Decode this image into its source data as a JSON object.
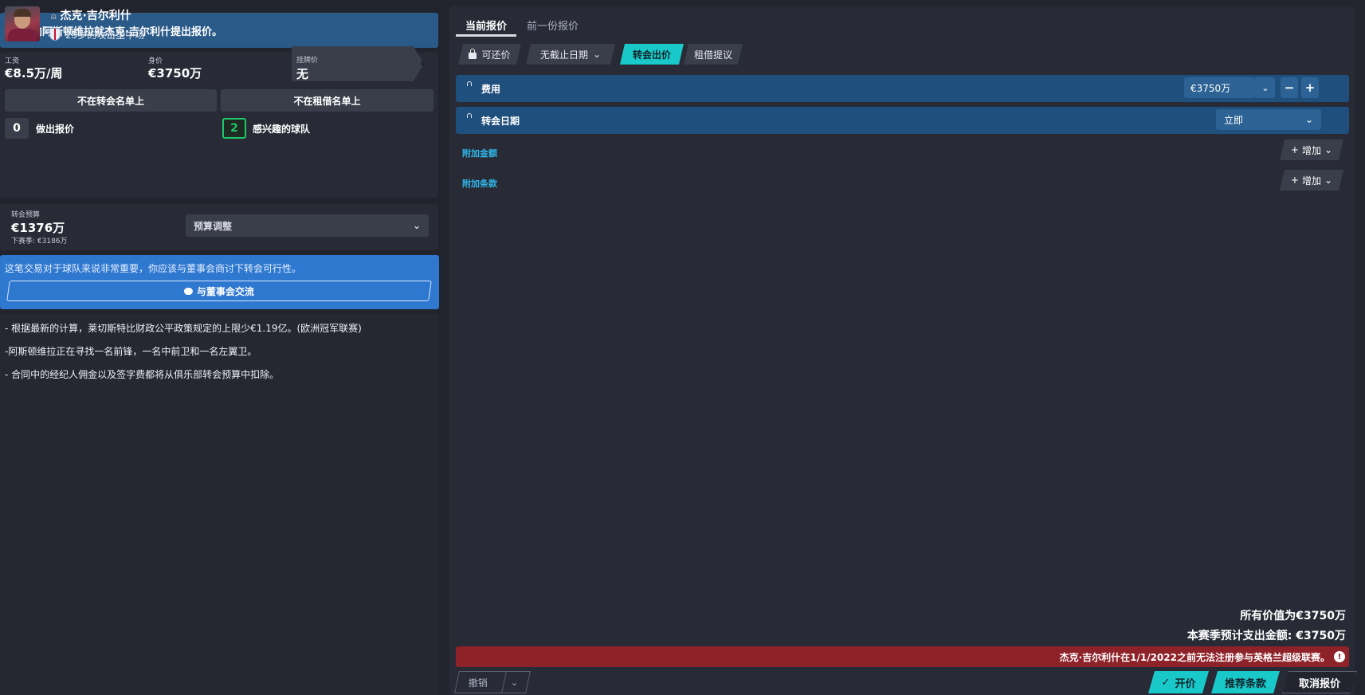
{
  "banner": {
    "text": "向阿斯顿维拉就杰克·吉尔利什提出报价。"
  },
  "player": {
    "name": "杰克·吉尔利什",
    "description": "25岁的攻击型中场",
    "wage_label": "工资",
    "wage_value": "€8.5万/周",
    "value_label": "身价",
    "value_value": "€3750万",
    "asking_label": "挂牌价",
    "asking_value": "无",
    "transfer_list_label": "不在转会名单上",
    "loan_list_label": "不在租借名单上",
    "offers_count": "0",
    "offers_label": "做出报价",
    "interested_count": "2",
    "interested_label": "感兴趣的球队"
  },
  "budget": {
    "label": "转会预算",
    "value": "€1376万",
    "next_season": "下赛季: €3186万",
    "adjust_label": "预算调整"
  },
  "board": {
    "message": "这笔交易对于球队来说非常重要，你应该与董事会商讨下转会可行性。",
    "button_label": "与董事会交流"
  },
  "notes": [
    "- 根据最新的计算，莱切斯特比财政公平政策规定的上限少€1.19亿。(欧洲冠军联赛)",
    "-阿斯顿维拉正在寻找一名前锋，一名中前卫和一名左翼卫。",
    "- 合同中的经纪人佣金以及签字费都将从俱乐部转会预算中扣除。"
  ],
  "tabs": {
    "current": "当前报价",
    "previous": "前一份报价"
  },
  "options": {
    "negotiable": "可还价",
    "deadline": "无截止日期",
    "transfer_offer": "转会出价",
    "loan_offer": "租借提议"
  },
  "terms": {
    "fee_label": "费用",
    "fee_value": "€3750万",
    "date_label": "转会日期",
    "date_value": "立即",
    "add_fee_link": "附加金额",
    "add_clause_link": "附加条款",
    "add_label": "增加"
  },
  "summary": {
    "total_value": "所有价值为€3750万",
    "season_spend": "本赛季预计支出金额: €3750万",
    "warning": "杰克·吉尔利什在1/1/2022之前无法注册参与英格兰超级联赛。"
  },
  "actions": {
    "undo": "撤销",
    "make_offer": "开价",
    "suggest_terms": "推荐条款",
    "cancel_offer": "取消报价"
  },
  "colors": {
    "accent": "#19c9c9",
    "term_row": "#1f4f7c",
    "board_blue": "#2f78d0",
    "warning_red": "#8e2229",
    "interest_green": "#1ec86a"
  }
}
